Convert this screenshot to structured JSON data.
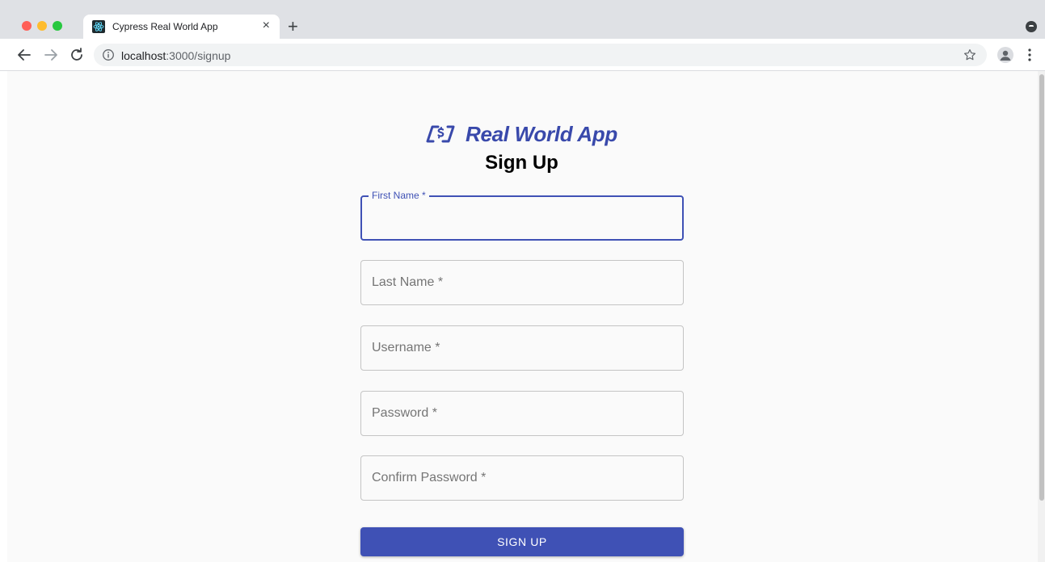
{
  "browser": {
    "tab_title": "Cypress Real World App",
    "tab_close": "×",
    "new_tab": "+",
    "url_host": "localhost",
    "url_path": ":3000/signup",
    "traffic_lights": [
      "#ff5f57",
      "#febc2e",
      "#28c840"
    ]
  },
  "app": {
    "logo_text": "Real World App",
    "brand_color": "#3f51b5",
    "page_title": "Sign Up"
  },
  "form": {
    "fields": [
      {
        "label": "First Name *",
        "value": "",
        "focused": true
      },
      {
        "label": "Last Name *",
        "value": "",
        "focused": false
      },
      {
        "label": "Username *",
        "value": "",
        "focused": false
      },
      {
        "label": "Password *",
        "value": "",
        "focused": false
      },
      {
        "label": "Confirm Password *",
        "value": "",
        "focused": false
      }
    ],
    "submit_label": "SIGN UP"
  },
  "icons": [
    "react-favicon-icon",
    "back-arrow-icon",
    "forward-arrow-icon",
    "reload-icon",
    "info-icon",
    "star-icon",
    "profile-icon",
    "menu-dots-icon",
    "logo-icon"
  ]
}
